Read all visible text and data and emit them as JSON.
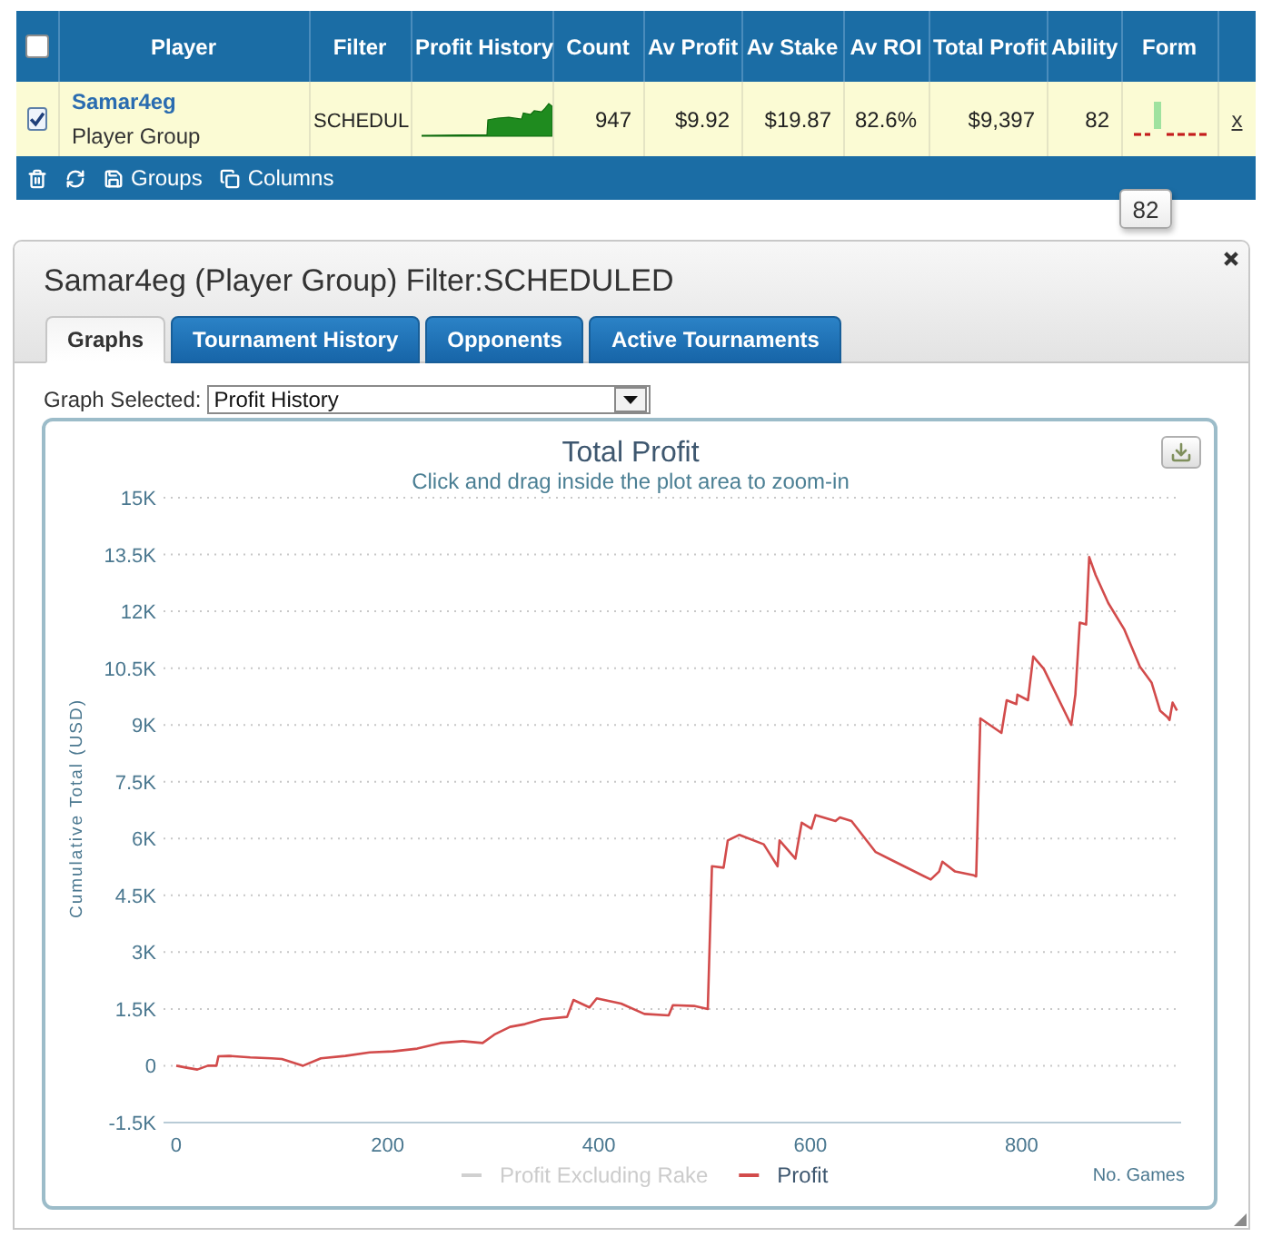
{
  "table": {
    "header_checkbox": {
      "checked": false
    },
    "columns": [
      "Player",
      "Filter",
      "Profit History",
      "Count",
      "Av Profit",
      "Av Stake",
      "Av ROI",
      "Total Profit",
      "Ability",
      "Form"
    ],
    "rows": [
      {
        "checked": true,
        "player": "Samar4eg",
        "player_type": "Player Group",
        "filter": "SCHEDUL",
        "count": "947",
        "av_profit": "$9.92",
        "av_stake": "$19.87",
        "av_roi": "82.6%",
        "total_profit": "$9,397",
        "ability": "82",
        "remove": "x"
      }
    ],
    "toolbar": [
      {
        "kind": "delete"
      },
      {
        "kind": "refresh"
      },
      {
        "kind": "groups",
        "label": "Groups"
      },
      {
        "kind": "columns",
        "label": "Columns"
      }
    ]
  },
  "tooltip": {
    "text": "82"
  },
  "panel": {
    "title": "Samar4eg (Player Group) Filter:SCHEDULED",
    "tabs": [
      {
        "label": "Graphs",
        "selected": true
      },
      {
        "label": "Tournament History",
        "selected": false
      },
      {
        "label": "Opponents",
        "selected": false
      },
      {
        "label": "Active Tournaments",
        "selected": false
      }
    ],
    "graph_select": {
      "label": "Graph Selected:",
      "value": "Profit History"
    },
    "chart": {
      "subtitle": "Click and drag inside the plot area to zoom-in",
      "legend": [
        {
          "label": "Profit Excluding Rake",
          "visible": false
        }
      ],
      "chart_data": {
        "type": "line",
        "title": "Total Profit",
        "xlabel": "No. Games",
        "ylabel": "Cumulative Total (USD)",
        "grid": true,
        "x": [
          0,
          10,
          20,
          30,
          38,
          40,
          50,
          70,
          90,
          100,
          120,
          137,
          160,
          183,
          205,
          228,
          250,
          271,
          290,
          301,
          316,
          330,
          346,
          370,
          376,
          391,
          398,
          421,
          443,
          466,
          470,
          490,
          503,
          507,
          518,
          522,
          533,
          556,
          569,
          571,
          586,
          592,
          601,
          605,
          624,
          628,
          639,
          662,
          677,
          714,
          722,
          725,
          737,
          755,
          757,
          759,
          761,
          781,
          786,
          795,
          796,
          806,
          811,
          821,
          847,
          851,
          855,
          861,
          864,
          870,
          882,
          897,
          912,
          923,
          931,
          938,
          940,
          943,
          947
        ],
        "series": [
          {
            "name": "Profit",
            "color": "#d24b4b",
            "values": [
              0,
              -50,
              -100,
              0,
              0,
              250,
              260,
              220,
              200,
              180,
              0,
              200,
              260,
              350,
              380,
              450,
              600,
              650,
              600,
              820,
              1030,
              1100,
              1230,
              1290,
              1740,
              1540,
              1780,
              1640,
              1370,
              1330,
              1600,
              1580,
              1500,
              5270,
              5230,
              5950,
              6100,
              5850,
              5270,
              5950,
              5470,
              6420,
              6260,
              6620,
              6460,
              6560,
              6460,
              5640,
              5430,
              4920,
              5130,
              5390,
              5130,
              5030,
              5000,
              6980,
              9170,
              8790,
              9650,
              9550,
              9800,
              9650,
              10810,
              10480,
              9000,
              9800,
              11700,
              11650,
              13430,
              12960,
              12220,
              11530,
              10540,
              10120,
              9380,
              9210,
              9130,
              9590,
              9380
            ]
          }
        ],
        "xlim": [
          -12,
          951
        ],
        "ylim": [
          -1500,
          15000
        ],
        "xticks": [
          0,
          200,
          400,
          600,
          800
        ],
        "yticks": [
          {
            "value": -1500,
            "label": "-1.5K"
          },
          0,
          {
            "value": 1500,
            "label": "1.5K"
          },
          {
            "value": 3000,
            "label": "3K"
          },
          {
            "value": 4500,
            "label": "4.5K"
          },
          {
            "value": 6000,
            "label": "6K"
          },
          {
            "value": 7500,
            "label": "7.5K"
          },
          {
            "value": 9000,
            "label": "9K"
          },
          {
            "value": 10500,
            "label": "10.5K"
          },
          {
            "value": 12000,
            "label": "12K"
          },
          {
            "value": 13500,
            "label": "13.5K"
          },
          {
            "value": 15000,
            "label": "15K"
          }
        ]
      }
    }
  }
}
